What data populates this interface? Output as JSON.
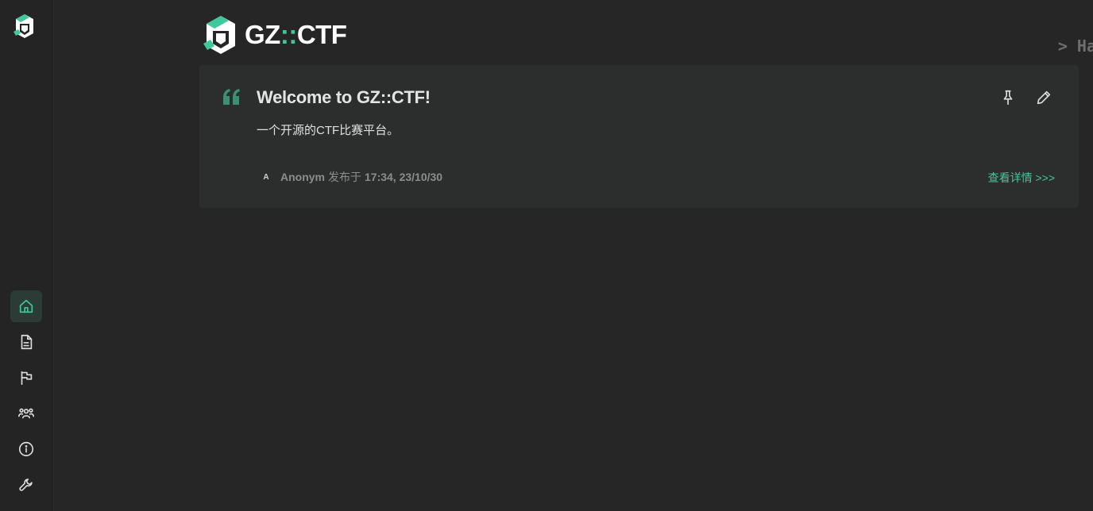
{
  "brand": {
    "name_left": "GZ",
    "name_sep": "::",
    "name_right": "CTF"
  },
  "hint_text": "> Ha",
  "sidebar": {
    "items": [
      {
        "name": "home",
        "icon": "home-icon",
        "active": true
      },
      {
        "name": "posts",
        "icon": "document-icon",
        "active": false
      },
      {
        "name": "games",
        "icon": "flag-icon",
        "active": false
      },
      {
        "name": "teams",
        "icon": "users-icon",
        "active": false
      },
      {
        "name": "about",
        "icon": "info-icon",
        "active": false
      },
      {
        "name": "admin",
        "icon": "wrench-icon",
        "active": false
      }
    ]
  },
  "post": {
    "title": "Welcome to GZ::CTF!",
    "summary": "一个开源的CTF比赛平台。",
    "avatar_letter": "A",
    "author": "Anonym",
    "published_label": "发布于",
    "published_time": "17:34, 23/10/30",
    "detail_link": "查看详情 >>>"
  },
  "colors": {
    "accent": "#3fc89c",
    "background": "#262626",
    "card": "#2c2e2e",
    "sidebar": "#242424"
  }
}
